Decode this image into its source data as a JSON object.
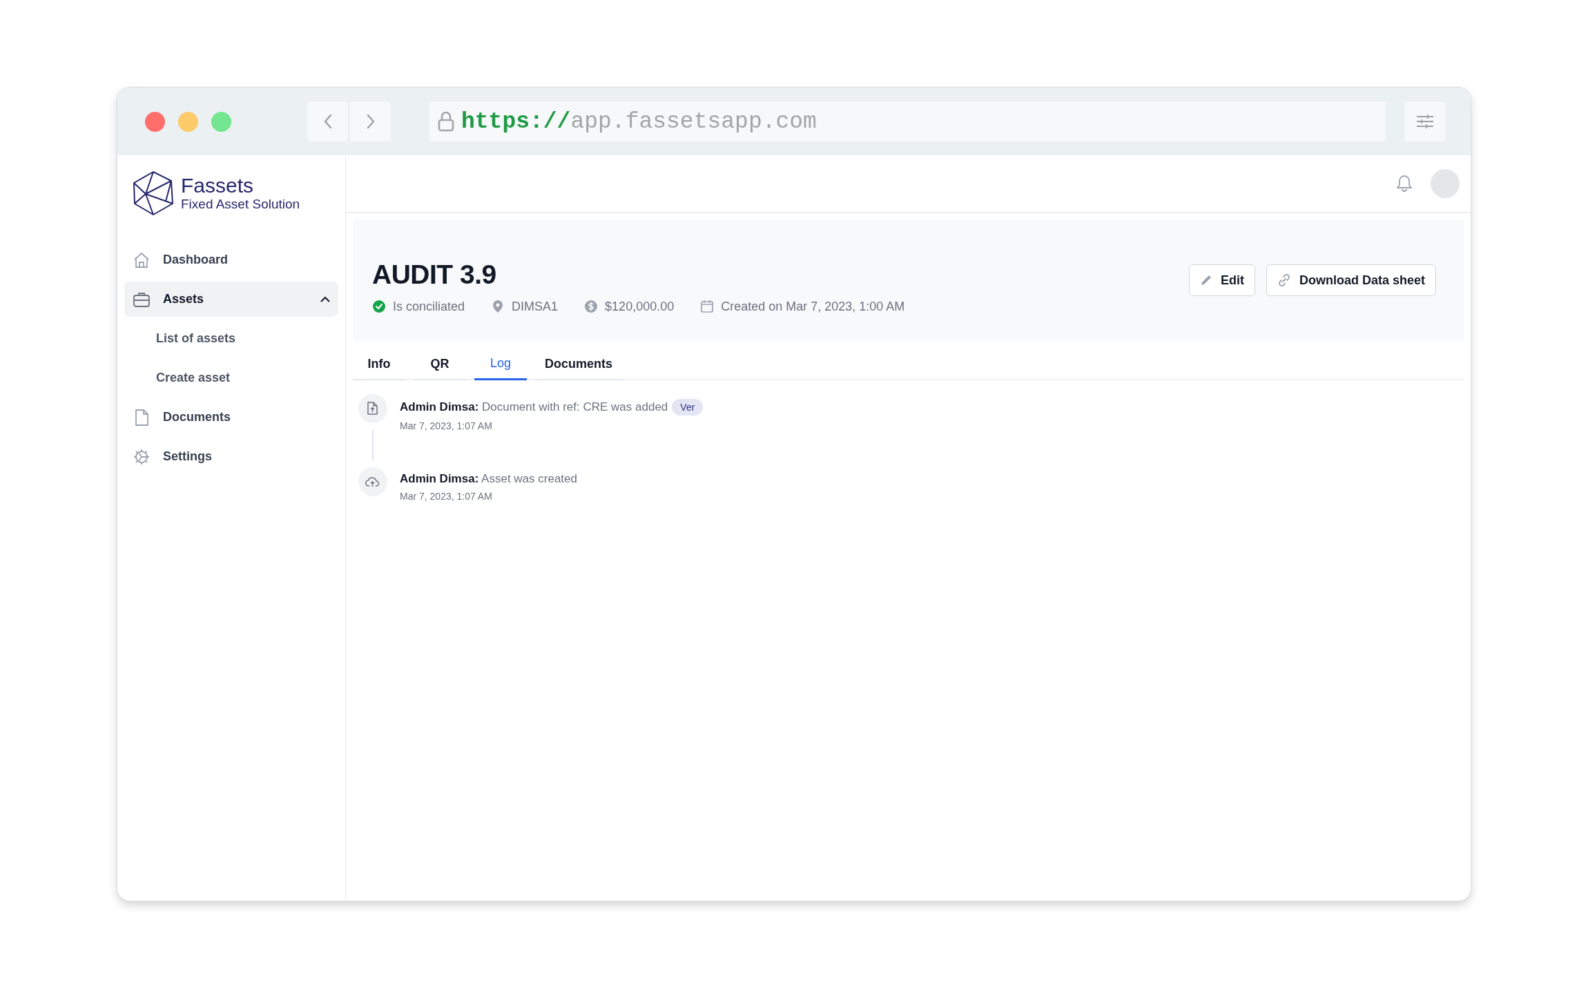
{
  "browser": {
    "url_scheme": "https://",
    "url_host": "app.fassetsapp.com"
  },
  "sidebar": {
    "logo": {
      "name": "Fassets",
      "tagline": "Fixed Asset Solution"
    },
    "items": [
      {
        "kind": "home",
        "label": "Dashboard",
        "selected": false
      },
      {
        "kind": "briefcase",
        "label": "Assets",
        "selected": true,
        "expanded": true,
        "children": [
          {
            "label": "List of assets",
            "selected": false
          },
          {
            "label": "Create asset",
            "selected": false
          }
        ]
      },
      {
        "kind": "document",
        "label": "Documents",
        "selected": false
      },
      {
        "kind": "gear",
        "label": "Settings",
        "selected": false
      }
    ]
  },
  "asset": {
    "title": "AUDIT 3.9",
    "meta": [
      {
        "kind": "status",
        "text": "Is conciliated"
      },
      {
        "kind": "location",
        "text": "DIMSA1"
      },
      {
        "kind": "price",
        "text": "$120,000.00"
      },
      {
        "kind": "date",
        "text": "Created on Mar 7, 2023, 1:00 AM"
      }
    ],
    "actions": [
      {
        "kind": "edit",
        "label": "Edit"
      },
      {
        "kind": "link",
        "label": "Download Data sheet"
      }
    ]
  },
  "tabs": [
    {
      "label": "Info",
      "selected": false
    },
    {
      "label": "QR",
      "selected": false
    },
    {
      "label": "Log",
      "selected": true
    },
    {
      "label": "Documents",
      "selected": false
    }
  ],
  "log": [
    {
      "kind": "document",
      "text": "**Admin Dimsa:** Document with ref: CRE was added",
      "badge": "Ver",
      "time": "Mar 7, 2023, 1:07 AM"
    },
    {
      "kind": "upload",
      "text": "**Admin Dimsa:** Asset was created",
      "time": "Mar 7, 2023, 1:07 AM"
    }
  ]
}
